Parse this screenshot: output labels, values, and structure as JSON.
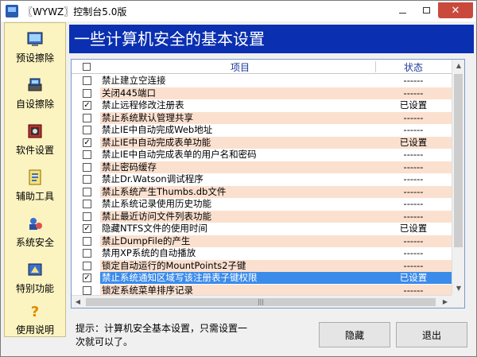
{
  "window": {
    "title": "〖WYWZ〗控制台5.0版",
    "minimize_label": "—",
    "close_label": "✕"
  },
  "sidebar": {
    "items": [
      {
        "label": "预设擦除",
        "icon": "preset-erase-icon"
      },
      {
        "label": "自设擦除",
        "icon": "custom-erase-icon"
      },
      {
        "label": "软件设置",
        "icon": "software-settings-icon"
      },
      {
        "label": "辅助工具",
        "icon": "tools-icon"
      },
      {
        "label": "系统安全",
        "icon": "system-security-icon"
      },
      {
        "label": "特别功能",
        "icon": "special-features-icon"
      },
      {
        "label": "使用说明",
        "icon": "help-icon"
      }
    ]
  },
  "banner": {
    "title": "一些计算机安全的基本设置"
  },
  "list": {
    "columns": {
      "item": "项目",
      "state": "状态"
    },
    "rows": [
      {
        "label": "禁止建立空连接",
        "state": "------",
        "checked": false
      },
      {
        "label": "关闭445端口",
        "state": "------",
        "checked": false
      },
      {
        "label": "禁止远程修改注册表",
        "state": "已设置",
        "checked": true
      },
      {
        "label": "禁止系统默认管理共享",
        "state": "------",
        "checked": false
      },
      {
        "label": "禁止IE中自动完成Web地址",
        "state": "------",
        "checked": false
      },
      {
        "label": "禁止IE中自动完成表单功能",
        "state": "已设置",
        "checked": true
      },
      {
        "label": "禁止IE中自动完成表单的用户名和密码",
        "state": "------",
        "checked": false
      },
      {
        "label": "禁止密码缓存",
        "state": "------",
        "checked": false
      },
      {
        "label": "禁止Dr.Watson调试程序",
        "state": "------",
        "checked": false
      },
      {
        "label": "禁止系统产生Thumbs.db文件",
        "state": "------",
        "checked": false
      },
      {
        "label": "禁止系统记录使用历史功能",
        "state": "------",
        "checked": false
      },
      {
        "label": "禁止最近访问文件列表功能",
        "state": "------",
        "checked": false
      },
      {
        "label": "隐藏NTFS文件的使用时间",
        "state": "已设置",
        "checked": true
      },
      {
        "label": "禁止DumpFile的产生",
        "state": "------",
        "checked": false
      },
      {
        "label": "禁用XP系统的自动播放",
        "state": "------",
        "checked": false
      },
      {
        "label": "锁定自动运行的MountPoints2子键",
        "state": "------",
        "checked": false
      },
      {
        "label": "禁止系统通知区域写该注册表子键权限",
        "state": "已设置",
        "checked": true
      },
      {
        "label": "锁定系统菜单排序记录",
        "state": "------",
        "checked": false
      }
    ]
  },
  "footer": {
    "hint": "提示：计算机安全基本设置，只需设置一次就可以了。",
    "hide_label": "隐藏",
    "exit_label": "退出"
  },
  "colors": {
    "banner": "#0a2fb0",
    "sidebar": "#fbf3c0",
    "row_alt": "#fbe0cf",
    "selected": "#3b8bea"
  }
}
